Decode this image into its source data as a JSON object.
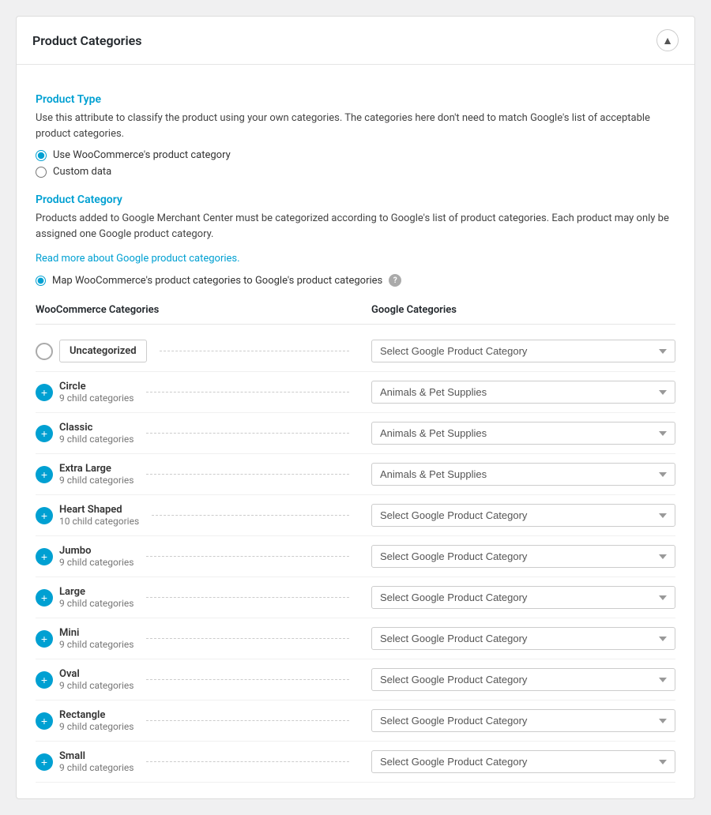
{
  "panel": {
    "title": "Product Categories",
    "collapse_label": "▲"
  },
  "product_type": {
    "section_title": "Product Type",
    "description": "Use this attribute to classify the product using your own categories. The categories here don't need to match Google's list of acceptable product categories.",
    "options": [
      {
        "label": "Use WooCommerce's product category",
        "selected": true
      },
      {
        "label": "Custom data",
        "selected": false
      }
    ]
  },
  "product_category": {
    "section_title": "Product Category",
    "description": "Products added to Google Merchant Center must be categorized according to Google's list of product categories. Each product may only be assigned one Google product category.",
    "link_text": "Read more about Google product categories.",
    "map_option_label": "Map WooCommerce's product categories to Google's product categories",
    "col_woo": "WooCommerce Categories",
    "col_google": "Google Categories"
  },
  "categories": [
    {
      "name": "Uncategorized",
      "children_label": "",
      "has_expand": false,
      "google_value": "Select Google Product Category",
      "is_uncat": true
    },
    {
      "name": "Circle",
      "children_label": "9 child categories",
      "has_expand": true,
      "google_value": "Animals & Pet Supplies"
    },
    {
      "name": "Classic",
      "children_label": "9 child categories",
      "has_expand": true,
      "google_value": "Animals & Pet Supplies"
    },
    {
      "name": "Extra Large",
      "children_label": "9 child categories",
      "has_expand": true,
      "google_value": "Animals & Pet Supplies"
    },
    {
      "name": "Heart Shaped",
      "children_label": "10 child categories",
      "has_expand": true,
      "google_value": "Select Google Product Category"
    },
    {
      "name": "Jumbo",
      "children_label": "9 child categories",
      "has_expand": true,
      "google_value": "Select Google Product Category"
    },
    {
      "name": "Large",
      "children_label": "9 child categories",
      "has_expand": true,
      "google_value": "Select Google Product Category"
    },
    {
      "name": "Mini",
      "children_label": "9 child categories",
      "has_expand": true,
      "google_value": "Select Google Product Category"
    },
    {
      "name": "Oval",
      "children_label": "9 child categories",
      "has_expand": true,
      "google_value": "Select Google Product Category"
    },
    {
      "name": "Rectangle",
      "children_label": "9 child categories",
      "has_expand": true,
      "google_value": "Select Google Product Category"
    },
    {
      "name": "Small",
      "children_label": "9 child categories",
      "has_expand": true,
      "google_value": "Select Google Product Category"
    }
  ],
  "icons": {
    "collapse": "&#9650;",
    "expand_plus": "+",
    "help": "?"
  }
}
